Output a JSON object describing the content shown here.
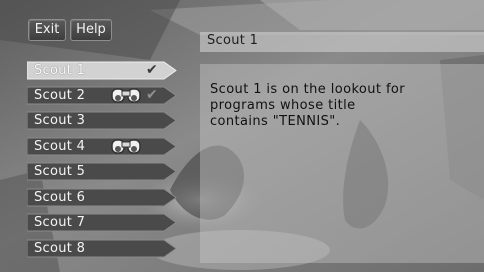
{
  "top_buttons": {
    "exit_label": "Exit",
    "help_label": "Help"
  },
  "scouts": [
    {
      "label": "Scout 1",
      "selected": true,
      "has_binoculars": false,
      "has_check": true
    },
    {
      "label": "Scout 2",
      "selected": false,
      "has_binoculars": true,
      "has_check": true
    },
    {
      "label": "Scout 3",
      "selected": false,
      "has_binoculars": false,
      "has_check": false
    },
    {
      "label": "Scout 4",
      "selected": false,
      "has_binoculars": true,
      "has_check": false
    },
    {
      "label": "Scout 5",
      "selected": false,
      "has_binoculars": false,
      "has_check": false
    },
    {
      "label": "Scout 6",
      "selected": false,
      "has_binoculars": false,
      "has_check": false
    },
    {
      "label": "Scout 7",
      "selected": false,
      "has_binoculars": false,
      "has_check": false
    },
    {
      "label": "Scout 8",
      "selected": false,
      "has_binoculars": false,
      "has_check": false
    }
  ],
  "detail": {
    "title": "Scout 1",
    "message_lines": [
      "Scout 1 is on the lookout for",
      "programs whose title",
      "contains \"TENNIS\"."
    ]
  },
  "icons": {
    "check": "checkmark-icon",
    "binoculars": "binoculars-icon"
  },
  "colors": {
    "selected_tab": "#d4d4d4",
    "tab": "#4a4a4a"
  }
}
